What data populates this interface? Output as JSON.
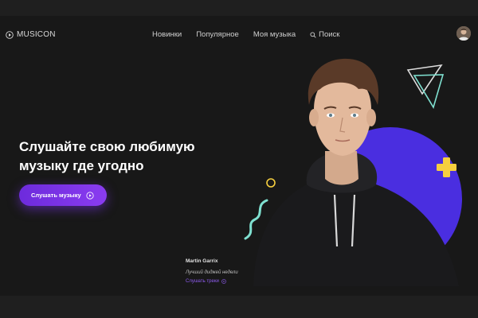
{
  "brand": {
    "name": "MUSICON",
    "logo_icon": "play-circle-icon"
  },
  "nav": {
    "items": [
      "Новинки",
      "Популярное",
      "Моя музыка"
    ],
    "search_label": "Поиск"
  },
  "hero": {
    "headline_line1": "Слушайте свою любимую",
    "headline_line2": "музыку где угодно",
    "cta_label": "Слушать музыку"
  },
  "artist_card": {
    "name": "Martin Garrix",
    "subtitle": "Лучший диджей недели",
    "link_label": "Слушать треки"
  },
  "colors": {
    "background": "#181818",
    "accent": "#7a35ea",
    "shape_blue": "#4a2ee0",
    "shape_yellow": "#f6cf3f",
    "shape_teal": "#7fe0d0"
  }
}
